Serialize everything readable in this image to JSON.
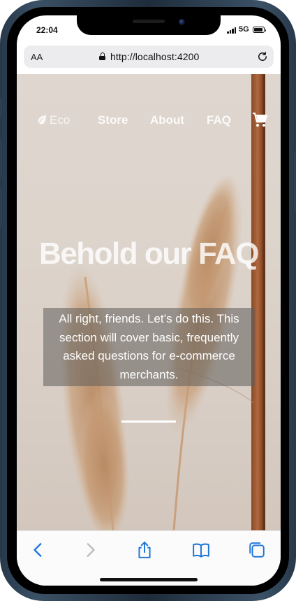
{
  "status_bar": {
    "time": "22:04",
    "network": "5G"
  },
  "browser": {
    "text_size_label": "AA",
    "url": "http://localhost:4200"
  },
  "nav": {
    "brand": "Eco",
    "links": [
      "Store",
      "About",
      "FAQ"
    ]
  },
  "hero": {
    "title": "Behold our FAQ",
    "lead": "All right, friends. Let’s do this. This section will cover basic, frequently asked questions for e-commerce merchants."
  },
  "colors": {
    "accent": "#1e74d8",
    "hero_bg": "#ddd4cc",
    "frame": "#2b3e52"
  },
  "icons": {
    "logo": "leaf-icon",
    "cart": "cart-icon",
    "toolbar": [
      "back-icon",
      "forward-icon",
      "share-icon",
      "bookmarks-icon",
      "tabs-icon"
    ]
  }
}
